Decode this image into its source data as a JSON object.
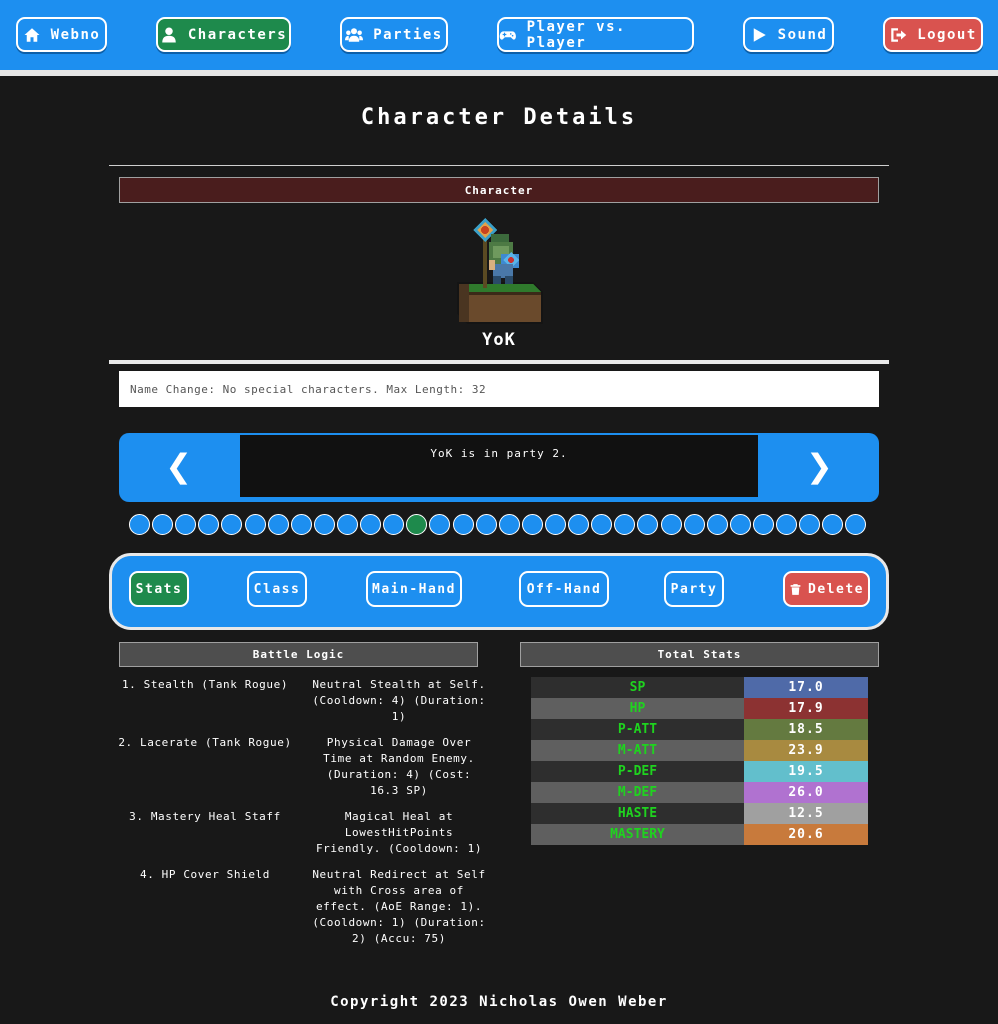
{
  "nav": {
    "home": "Webno",
    "characters": "Characters",
    "parties": "Parties",
    "pvp": "Player vs. Player",
    "sound": "Sound",
    "logout": "Logout"
  },
  "page_title": "Character Details",
  "character": {
    "header": "Character",
    "name": "YoK",
    "name_change_placeholder": "Name Change: No special characters. Max Length: 32"
  },
  "party": {
    "prev_label": "❮",
    "next_label": "❯",
    "status": "YoK is in party 2.",
    "total_dots": 32,
    "active_dot": 13
  },
  "tabs": {
    "stats": "Stats",
    "class": "Class",
    "main_hand": "Main-Hand",
    "off_hand": "Off-Hand",
    "party": "Party",
    "delete": "Delete"
  },
  "battle_logic": {
    "title": "Battle Logic",
    "items": [
      {
        "name": "1. Stealth (Tank Rogue)",
        "desc": "Neutral Stealth at Self. (Cooldown: 4) (Duration: 1)"
      },
      {
        "name": "2. Lacerate (Tank Rogue)",
        "desc": "Physical Damage Over Time at Random Enemy. (Duration: 4) (Cost: 16.3 SP)"
      },
      {
        "name": "3. Mastery Heal Staff",
        "desc": "Magical Heal at LowestHitPoints Friendly. (Cooldown: 1)"
      },
      {
        "name": "4. HP Cover Shield",
        "desc": "Neutral Redirect at Self with Cross area of effect. (AoE Range: 1). (Cooldown: 1) (Duration: 2) (Accu: 75)"
      }
    ]
  },
  "total_stats": {
    "title": "Total Stats",
    "rows": [
      {
        "label": "SP",
        "value": "17.0",
        "color": "#4f6aa8"
      },
      {
        "label": "HP",
        "value": "17.9",
        "color": "#8c3232"
      },
      {
        "label": "P-ATT",
        "value": "18.5",
        "color": "#647a40"
      },
      {
        "label": "M-ATT",
        "value": "23.9",
        "color": "#a88a40"
      },
      {
        "label": "P-DEF",
        "value": "19.5",
        "color": "#62bfcc"
      },
      {
        "label": "M-DEF",
        "value": "26.0",
        "color": "#b072d0"
      },
      {
        "label": "HASTE",
        "value": "12.5",
        "color": "#a0a0a0"
      },
      {
        "label": "MASTERY",
        "value": "20.6",
        "color": "#c87a3c"
      }
    ]
  },
  "footer": "Copyright 2023 Nicholas Owen Weber"
}
